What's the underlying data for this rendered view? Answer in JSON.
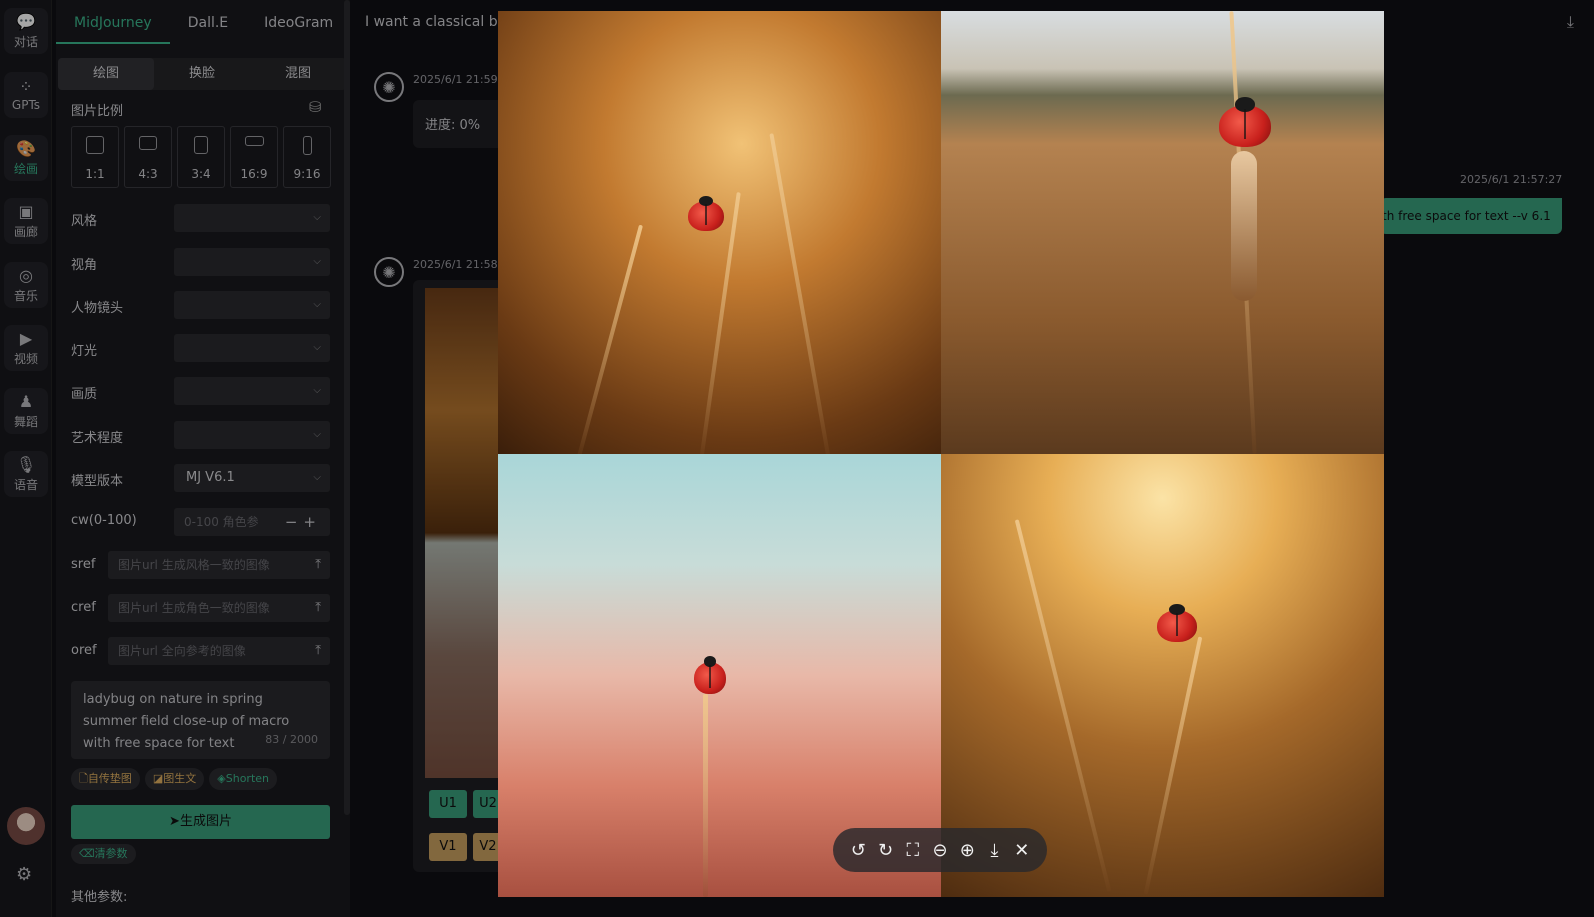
{
  "rail": [
    {
      "label": "对话",
      "icon": "chat-icon",
      "glyph": "💬"
    },
    {
      "label": "GPTs",
      "icon": "grid-icon",
      "glyph": "⁘"
    },
    {
      "label": "绘画",
      "icon": "palette-icon",
      "glyph": "🎨"
    },
    {
      "label": "画廊",
      "icon": "gallery-icon",
      "glyph": "▣"
    },
    {
      "label": "音乐",
      "icon": "music-icon",
      "glyph": "◎"
    },
    {
      "label": "视频",
      "icon": "video-icon",
      "glyph": "▶"
    },
    {
      "label": "舞蹈",
      "icon": "dance-icon",
      "glyph": "♟"
    },
    {
      "label": "语音",
      "icon": "mic-icon",
      "glyph": "🎙"
    }
  ],
  "tabs": [
    "MidJourney",
    "Dall.E",
    "IdeoGram"
  ],
  "seg": [
    "绘图",
    "换脸",
    "混图"
  ],
  "ratio_title": "图片比例",
  "ratios": [
    "1:1",
    "4:3",
    "3:4",
    "16:9",
    "9:16"
  ],
  "fields": {
    "style": "风格",
    "view": "视角",
    "lens": "人物镜头",
    "light": "灯光",
    "quality": "画质",
    "art": "艺术程度",
    "model": "模型版本",
    "model_value": "MJ V6.1",
    "cw": "cw(0-100)",
    "cw_placeholder": "0-100 角色参",
    "sref": "sref",
    "sref_placeholder": "图片url 生成风格一致的图像",
    "cref": "cref",
    "cref_placeholder": "图片url 生成角色一致的图像",
    "oref": "oref",
    "oref_placeholder": "图片url 全向参考的图像"
  },
  "prompt": "ladybug on nature in spring summer field close-up of macro with free space for text",
  "prompt_count": "83 / 2000",
  "chips": [
    "自传垫图",
    "图生文",
    "Shorten"
  ],
  "generate": "生成图片",
  "clear": "清参数",
  "other": "其他参数:",
  "chat": {
    "title": "I want a classical be",
    "msg1_time": "2025/6/1 21:59",
    "progress": "进度: 0%",
    "msg2_time": "2025/6/1 21:58",
    "u_buttons": [
      "U1",
      "U2"
    ],
    "v_buttons": [
      "V1",
      "V2"
    ],
    "user_time": "2025/6/1 21:57:27",
    "user_text": "th free space for text --v 6.1"
  },
  "colors": {
    "accent": "#3a9e7c",
    "accent_text": "#3bb58c",
    "variation": "#c8a060"
  }
}
